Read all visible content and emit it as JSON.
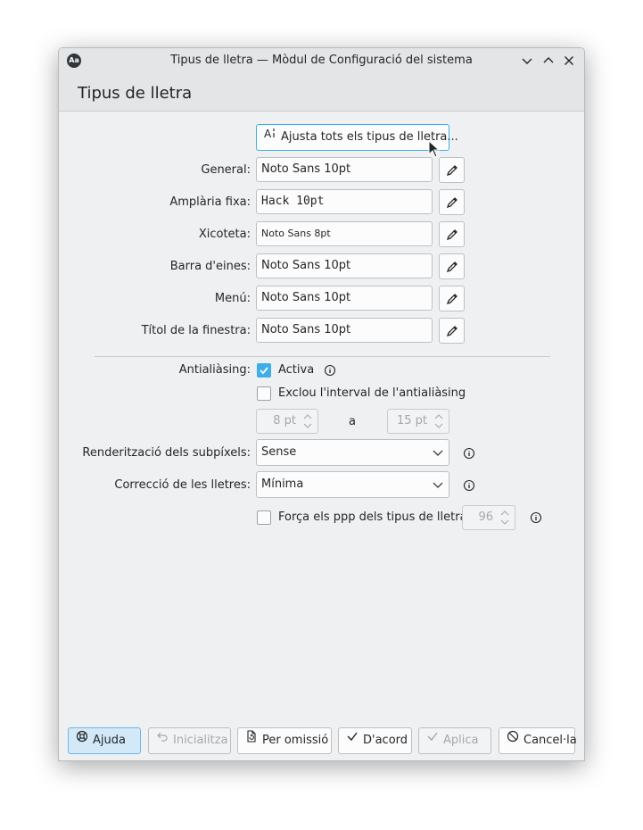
{
  "window": {
    "title": "Tipus de lletra — Mòdul de Configuració del sistema",
    "app_icon_text": "Aa"
  },
  "page": {
    "title": "Tipus de lletra"
  },
  "adjust_all_button": "Ajusta tots els tipus de lletra...",
  "fonts": [
    {
      "label": "General:",
      "value": "Noto Sans 10pt"
    },
    {
      "label": "Amplària fixa:",
      "value": "Hack 10pt"
    },
    {
      "label": "Xicoteta:",
      "value": "Noto Sans 8pt"
    },
    {
      "label": "Barra d'eines:",
      "value": "Noto Sans 10pt"
    },
    {
      "label": "Menú:",
      "value": "Noto Sans 10pt"
    },
    {
      "label": "Títol de la finestra:",
      "value": "Noto Sans 10pt"
    }
  ],
  "antialiasing": {
    "label": "Antialiàsing:",
    "enable_label": "Activa",
    "enabled": true,
    "exclude_label": "Exclou l'interval de l'antialiàsing",
    "exclude_checked": false,
    "from_value": "8 pt",
    "to_label": "a",
    "to_value": "15 pt"
  },
  "subpixel": {
    "label": "Renderització dels subpíxels:",
    "value": "Sense"
  },
  "hinting": {
    "label": "Correcció de les lletres:",
    "value": "Mínima"
  },
  "force_dpi": {
    "label": "Força els ppp dels tipus de lletra:",
    "checked": false,
    "value": "96"
  },
  "buttons": {
    "help": "Ajuda",
    "reset": "Inicialitza",
    "defaults": "Per omissió",
    "ok": "D'acord",
    "apply": "Aplica",
    "cancel": "Cancel·la"
  },
  "colors": {
    "accent": "#3daee9",
    "window_bg": "#eff0f1"
  }
}
